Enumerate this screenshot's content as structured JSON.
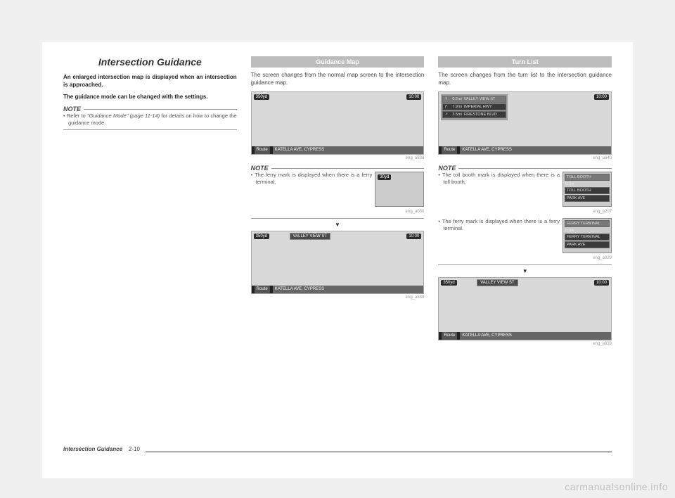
{
  "page_title": "Intersection Guidance",
  "intro1": "An enlarged intersection map is displayed when an intersection is approached.",
  "intro2": "The guidance mode can be changed with the settings.",
  "note_label": "NOTE",
  "col1_note_bullet_prefix": "Refer to ",
  "col1_note_bullet_ref": "\"Guidance Mode\" (page 11-14)",
  "col1_note_bullet_suffix": " for details on how to change the guidance mode.",
  "col2_header": "Guidance Map",
  "col2_desc": "The screen changes from the normal map screen to the intersection guidance map.",
  "fig_distance": "350yd",
  "fig_time": "10:00",
  "fig_route": "Route",
  "fig_address": "KATELLA AVE, CYPRESS",
  "fig_sign": "VALLEY VIEW ST",
  "cap_a638": "eng_a638",
  "col2_note_bullet": "The ferry mark is displayed when there is a ferry terminal.",
  "mini_badge_30": "30yd",
  "cap_a030": "eng_a030",
  "cap_a639": "eng_a639",
  "col3_header": "Turn List",
  "col3_desc": "The screen changes from the turn list to the intersection guidance map.",
  "turns": [
    {
      "dist": "0.2mi",
      "name": "VALLEY VIEW ST"
    },
    {
      "dist": "7.9mi",
      "name": "IMPERIAL HWY"
    },
    {
      "dist": "3.5mi",
      "name": "FIRESTONE BLVD"
    }
  ],
  "cap_a640": "eng_a640",
  "col3_note1_bullet": "The toll booth mark is displayed when there is a toll booth.",
  "toll_list": [
    "TOLL BOOTH",
    "TOLL BOOTH",
    "PARK AVE"
  ],
  "toll_dist": "0.1mi",
  "cap_a207": "eng_a207",
  "col3_note2_bullet": "The ferry mark is displayed when there is a ferry terminal.",
  "ferry_list": [
    "FERRY TERMINAL",
    "FERRY TERMINAL",
    "PARK AVE"
  ],
  "cap_a029": "eng_a029",
  "footer_bold": "Intersection Guidance",
  "footer_page": "2-10",
  "watermark": "carmanualsonline.info",
  "arrow": "▼"
}
